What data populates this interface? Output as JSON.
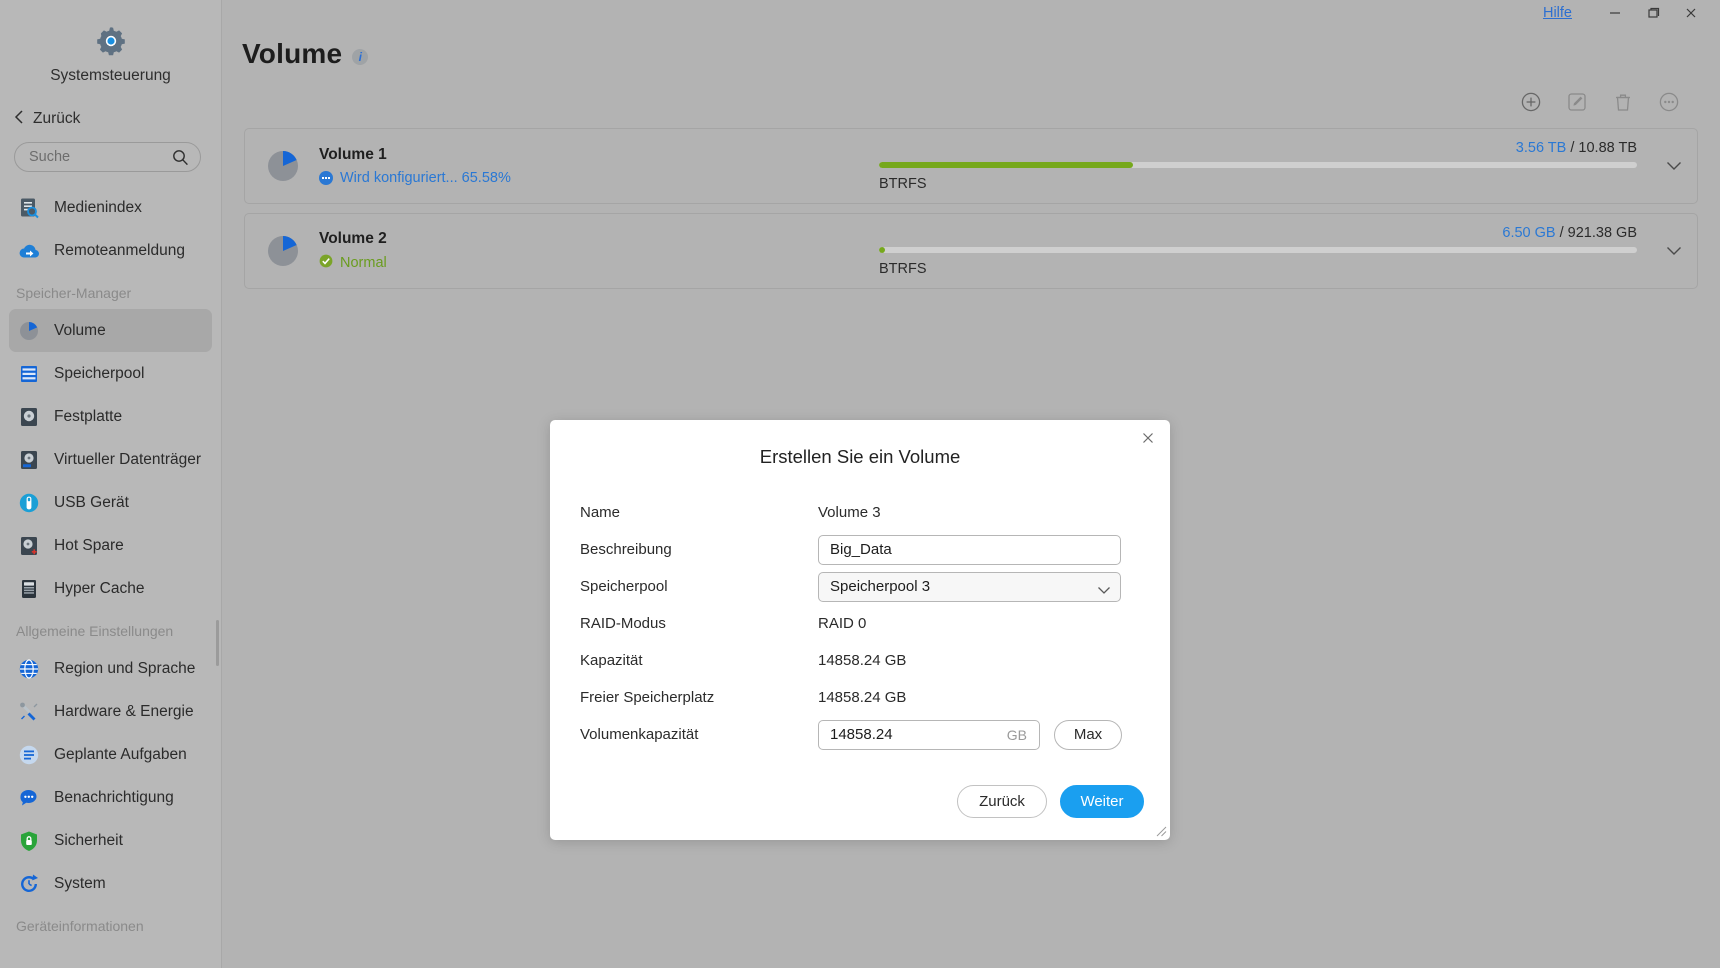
{
  "titlebar": {
    "help_label": "Hilfe",
    "minimize_icon": "minimize-icon",
    "maximize_icon": "maximize-icon",
    "close_icon": "close-icon"
  },
  "sidebar": {
    "app_title": "Systemsteuerung",
    "back_label": "Zurück",
    "search_placeholder": "Suche",
    "search_value": "",
    "top_items": [
      {
        "label": "Medienindex",
        "icon": "media-index-icon"
      },
      {
        "label": "Remoteanmeldung",
        "icon": "remote-login-icon"
      }
    ],
    "groups": [
      {
        "title": "Speicher-Manager",
        "items": [
          {
            "label": "Volume",
            "icon": "volume-pie-icon",
            "active": true
          },
          {
            "label": "Speicherpool",
            "icon": "storage-pool-icon",
            "active": false
          },
          {
            "label": "Festplatte",
            "icon": "hard-disk-icon",
            "active": false
          },
          {
            "label": "Virtueller Datenträger",
            "icon": "virtual-disk-icon",
            "active": false
          },
          {
            "label": "USB Gerät",
            "icon": "usb-device-icon",
            "active": false
          },
          {
            "label": "Hot Spare",
            "icon": "hot-spare-icon",
            "active": false
          },
          {
            "label": "Hyper Cache",
            "icon": "hyper-cache-icon",
            "active": false
          }
        ]
      },
      {
        "title": "Allgemeine Einstellungen",
        "items": [
          {
            "label": "Region und Sprache",
            "icon": "globe-icon",
            "active": false
          },
          {
            "label": "Hardware & Energie",
            "icon": "tools-icon",
            "active": false
          },
          {
            "label": "Geplante Aufgaben",
            "icon": "scheduled-tasks-icon",
            "active": false
          },
          {
            "label": "Benachrichtigung",
            "icon": "notification-icon",
            "active": false
          },
          {
            "label": "Sicherheit",
            "icon": "shield-lock-icon",
            "active": false
          },
          {
            "label": "System",
            "icon": "system-refresh-icon",
            "active": false
          }
        ]
      },
      {
        "title": "Geräteinformationen",
        "items": []
      }
    ]
  },
  "main": {
    "page_title": "Volume",
    "info_badge": "i",
    "toolbar": [
      {
        "name": "add-volume-button",
        "icon": "plus-circle-icon",
        "enabled": true
      },
      {
        "name": "edit-volume-button",
        "icon": "pencil-square-icon",
        "enabled": false
      },
      {
        "name": "delete-volume-button",
        "icon": "trash-icon",
        "enabled": false
      },
      {
        "name": "more-actions-button",
        "icon": "ellipsis-circle-icon",
        "enabled": false
      }
    ],
    "volumes": [
      {
        "name": "Volume 1",
        "status": "Wird konfiguriert... 65.58%",
        "status_type": "configuring",
        "used": "3.56 TB",
        "separator": "/",
        "total": "10.88 TB",
        "fs": "BTRFS",
        "fill_percent": 33.5
      },
      {
        "name": "Volume 2",
        "status": "Normal",
        "status_type": "normal",
        "used": "6.50 GB",
        "separator": "/",
        "total": "921.38 GB",
        "fs": "BTRFS",
        "fill_percent": 0.8
      }
    ]
  },
  "dialog": {
    "title": "Erstellen Sie ein Volume",
    "close_icon": "close-icon",
    "fields": [
      {
        "label": "Name",
        "type": "static",
        "value": "Volume 3"
      },
      {
        "label": "Beschreibung",
        "type": "text",
        "value": "Big_Data"
      },
      {
        "label": "Speicherpool",
        "type": "select",
        "value": "Speicherpool 3"
      },
      {
        "label": "RAID-Modus",
        "type": "static",
        "value": "RAID 0"
      },
      {
        "label": "Kapazität",
        "type": "static",
        "value": "14858.24 GB"
      },
      {
        "label": "Freier Speicherplatz",
        "type": "static",
        "value": "14858.24 GB"
      },
      {
        "label": "Volumenkapazität",
        "type": "number",
        "value": "14858.24",
        "unit": "GB",
        "button": "Max"
      }
    ],
    "back_label": "Zurück",
    "next_label": "Weiter"
  },
  "colors": {
    "accent_blue": "#2a78d4",
    "primary_button": "#1a9ff0",
    "bar_green": "#76a81c",
    "status_green": "#6a9c1f"
  }
}
